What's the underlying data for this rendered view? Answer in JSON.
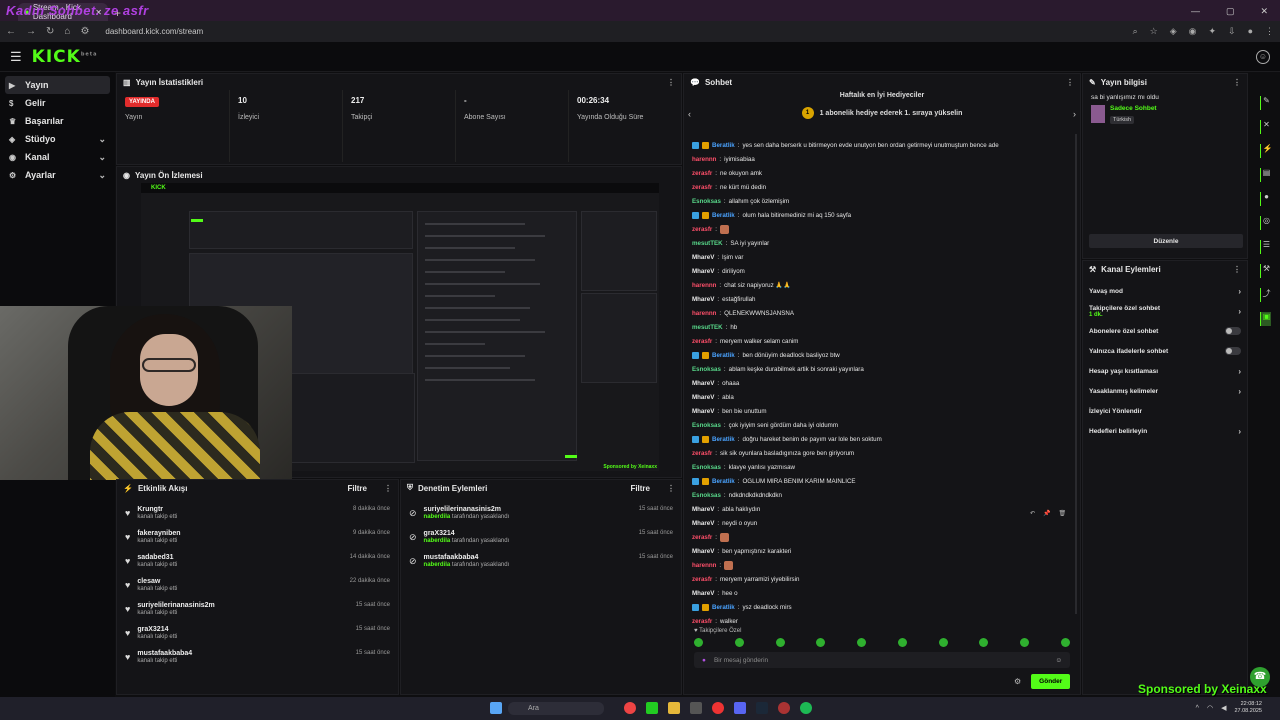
{
  "overlay_text": "Kadın Sohbet. ze asfr",
  "browser": {
    "tab_title": "Stream · Kick Dashboard",
    "url": "dashboard.kick.com/stream"
  },
  "brand": {
    "logo": "KICK",
    "logo_sup": "beta",
    "accent": "#53fc18"
  },
  "nav": [
    {
      "label": "Yayın",
      "icon": "video-icon",
      "active": true,
      "chevron": false
    },
    {
      "label": "Gelir",
      "icon": "money-icon",
      "active": false,
      "chevron": false
    },
    {
      "label": "Başarılar",
      "icon": "trophy-icon",
      "active": false,
      "chevron": false
    },
    {
      "label": "Stüdyo",
      "icon": "studio-icon",
      "active": false,
      "chevron": true
    },
    {
      "label": "Kanal",
      "icon": "channel-icon",
      "active": false,
      "chevron": true
    },
    {
      "label": "Ayarlar",
      "icon": "gear-icon",
      "active": false,
      "chevron": true
    }
  ],
  "stats_panel": {
    "title": "Yayın İstatistikleri",
    "live_badge": "YAYINDA",
    "items": [
      {
        "value": "",
        "label": "Yayın",
        "badge": true
      },
      {
        "value": "10",
        "label": "İzleyici"
      },
      {
        "value": "217",
        "label": "Takipçi"
      },
      {
        "value": "-",
        "label": "Abone Sayısı"
      },
      {
        "value": "00:26:34",
        "label": "Yayında Olduğu Süre"
      }
    ]
  },
  "preview_panel": {
    "title": "Yayın Ön İzlemesi",
    "sponsor": "Sponsored by Xeinaxx"
  },
  "activity_panel": {
    "title": "Etkinlik Akışı",
    "filter": "Filtre",
    "items": [
      {
        "name": "Krungtr",
        "sub": "kanalı takip etti",
        "time": "8 dakika önce"
      },
      {
        "name": "fakerayniben",
        "sub": "kanalı takip etti",
        "time": "9 dakika önce"
      },
      {
        "name": "sadabed31",
        "sub": "kanalı takip etti",
        "time": "14 dakika önce"
      },
      {
        "name": "clesaw",
        "sub": "kanalı takip etti",
        "time": "22 dakika önce"
      },
      {
        "name": "suriyelilerinanasinis2m",
        "sub": "kanalı takip etti",
        "time": "15 saat önce"
      },
      {
        "name": "graX3214",
        "sub": "kanalı takip etti",
        "time": "15 saat önce"
      },
      {
        "name": "mustafaakbaba4",
        "sub": "kanalı takip etti",
        "time": "15 saat önce"
      }
    ]
  },
  "moderation_panel": {
    "title": "Denetim Eylemleri",
    "filter": "Filtre",
    "items": [
      {
        "name": "suriyelilerinanasinis2m",
        "by": "naberdila",
        "sub": " tarafından yasaklandı",
        "time": "15 saat önce"
      },
      {
        "name": "graX3214",
        "by": "naberdila",
        "sub": " tarafından yasaklandı",
        "time": "15 saat önce"
      },
      {
        "name": "mustafaakbaba4",
        "by": "naberdila",
        "sub": " tarafından yasaklandı",
        "time": "15 saat önce"
      }
    ]
  },
  "chat": {
    "title": "Sohbet",
    "top_gifters": "Haftalık en İyi Hediyeciler",
    "gift_rank": "1",
    "gift_text": "1 abonelik hediye ederek 1. sıraya yükselin",
    "messages": [
      {
        "user": "Beratlik",
        "color": "#4aa3ff",
        "badges": true,
        "text": "yes sen daha berserk u bitirmeyon evde unutyon ben ordan getirmeyi unutmuştum bence ade"
      },
      {
        "user": "harennn",
        "color": "#ff4f6a",
        "text": "iyimisabiaa"
      },
      {
        "user": "zerasfr",
        "color": "#ff4f6a",
        "text": "ne okuyon amk"
      },
      {
        "user": "zerasfr",
        "color": "#ff4f6a",
        "text": "ne kürt mü dedin"
      },
      {
        "user": "Esnoksas",
        "color": "#58d88a",
        "text": "allahım çok özlemişim"
      },
      {
        "user": "Beratlik",
        "color": "#4aa3ff",
        "badges": true,
        "text": "olum hala bitiremediniz mi aq 150 sayfa"
      },
      {
        "user": "zerasfr",
        "color": "#ff4f6a",
        "text": "",
        "emote": true
      },
      {
        "user": "mesutTEK",
        "color": "#58d88a",
        "text": "SA iyi yayınlar"
      },
      {
        "user": "MhareV",
        "color": "#e6e6e6",
        "text": "lşim var"
      },
      {
        "user": "MhareV",
        "color": "#e6e6e6",
        "text": "diriliyom"
      },
      {
        "user": "harennn",
        "color": "#ff4f6a",
        "text": "chat siz napiyoruz 🙏🙏"
      },
      {
        "user": "MhareV",
        "color": "#e6e6e6",
        "text": "estağfirullah"
      },
      {
        "user": "harennn",
        "color": "#ff4f6a",
        "text": "QLENEKWWNSJANSNA"
      },
      {
        "user": "mesutTEK",
        "color": "#58d88a",
        "text": "hb"
      },
      {
        "user": "zerasfr",
        "color": "#ff4f6a",
        "text": "meryem walker selam canim"
      },
      {
        "user": "Beratlik",
        "color": "#4aa3ff",
        "badges": true,
        "text": "ben dönüyim deadlock basliyoz btw"
      },
      {
        "user": "Esnoksas",
        "color": "#58d88a",
        "text": "ablam keşke durabilmek artik bi sonraki yayınlara"
      },
      {
        "user": "MhareV",
        "color": "#e6e6e6",
        "text": "ohaaa"
      },
      {
        "user": "MhareV",
        "color": "#e6e6e6",
        "text": "abla"
      },
      {
        "user": "MhareV",
        "color": "#e6e6e6",
        "text": "ben bie unuttum"
      },
      {
        "user": "Esnoksas",
        "color": "#58d88a",
        "text": "çok iyiyim seni gördüm daha iyi oldumm"
      },
      {
        "user": "Beratlik",
        "color": "#4aa3ff",
        "badges": true,
        "text": "doğru hareket benim de payım var lole ben soktum"
      },
      {
        "user": "zerasfr",
        "color": "#ff4f6a",
        "text": "sik sik oyunlara basladıgınıza gore ben giriyorum"
      },
      {
        "user": "Esnoksas",
        "color": "#58d88a",
        "text": "klavye yanlısı yazmısaw"
      },
      {
        "user": "Beratlik",
        "color": "#4aa3ff",
        "badges": true,
        "text": "OGLUM MIRA BENIM KARIM MAINLICE"
      },
      {
        "user": "Esnoksas",
        "color": "#58d88a",
        "text": "ndkdndkdkdndkdkn"
      },
      {
        "user": "MhareV",
        "color": "#e6e6e6",
        "text": "abla haklıydın"
      },
      {
        "user": "MhareV",
        "color": "#e6e6e6",
        "text": "neydi o oyun"
      },
      {
        "user": "zerasfr",
        "color": "#ff4f6a",
        "text": "",
        "emote": true
      },
      {
        "user": "MhareV",
        "color": "#e6e6e6",
        "text": "ben yapmıştınız karakteri"
      },
      {
        "user": "harennn",
        "color": "#ff4f6a",
        "text": "",
        "emote": true
      },
      {
        "user": "zerasfr",
        "color": "#ff4f6a",
        "text": "meryem yarramizi yiyebilirsin"
      },
      {
        "user": "MhareV",
        "color": "#e6e6e6",
        "text": "hee o"
      },
      {
        "user": "Beratlik",
        "color": "#4aa3ff",
        "badges": true,
        "text": "ysz deadlock mirs"
      },
      {
        "user": "zerasfr",
        "color": "#ff4f6a",
        "text": "walker"
      }
    ],
    "follower_only": "Takipçilere Özel",
    "input_placeholder": "Bir mesaj gönderin",
    "send_label": "Gönder"
  },
  "stream_info": {
    "title": "Yayın bilgisi",
    "text": "sa bi yanlışımız mı oldu",
    "category": "Sadece Sohbet",
    "language": "Türkish",
    "edit_label": "Düzenle"
  },
  "channel_actions": {
    "title": "Kanal Eylemleri",
    "items": [
      {
        "label": "Yavaş mod",
        "type": "chevron"
      },
      {
        "label": "Takipçilere özel sohbet",
        "sub": "1 dk.",
        "type": "chevron"
      },
      {
        "label": "Abonelere özel sohbet",
        "type": "toggle"
      },
      {
        "label": "Yalnızca ifadelerle sohbet",
        "type": "toggle"
      },
      {
        "label": "Hesap yaşı kısıtlaması",
        "type": "chevron"
      },
      {
        "label": "Yasaklanmış kelimeler",
        "type": "chevron"
      },
      {
        "label": "İzleyici Yönlendir",
        "type": "none"
      },
      {
        "label": "Hedefleri belirleyin",
        "type": "chevron"
      }
    ]
  },
  "sponsor_text": "Sponsored by Xeinaxx",
  "taskbar": {
    "search": "Ara",
    "time": "22:08:12",
    "date": "27.08.2025"
  }
}
